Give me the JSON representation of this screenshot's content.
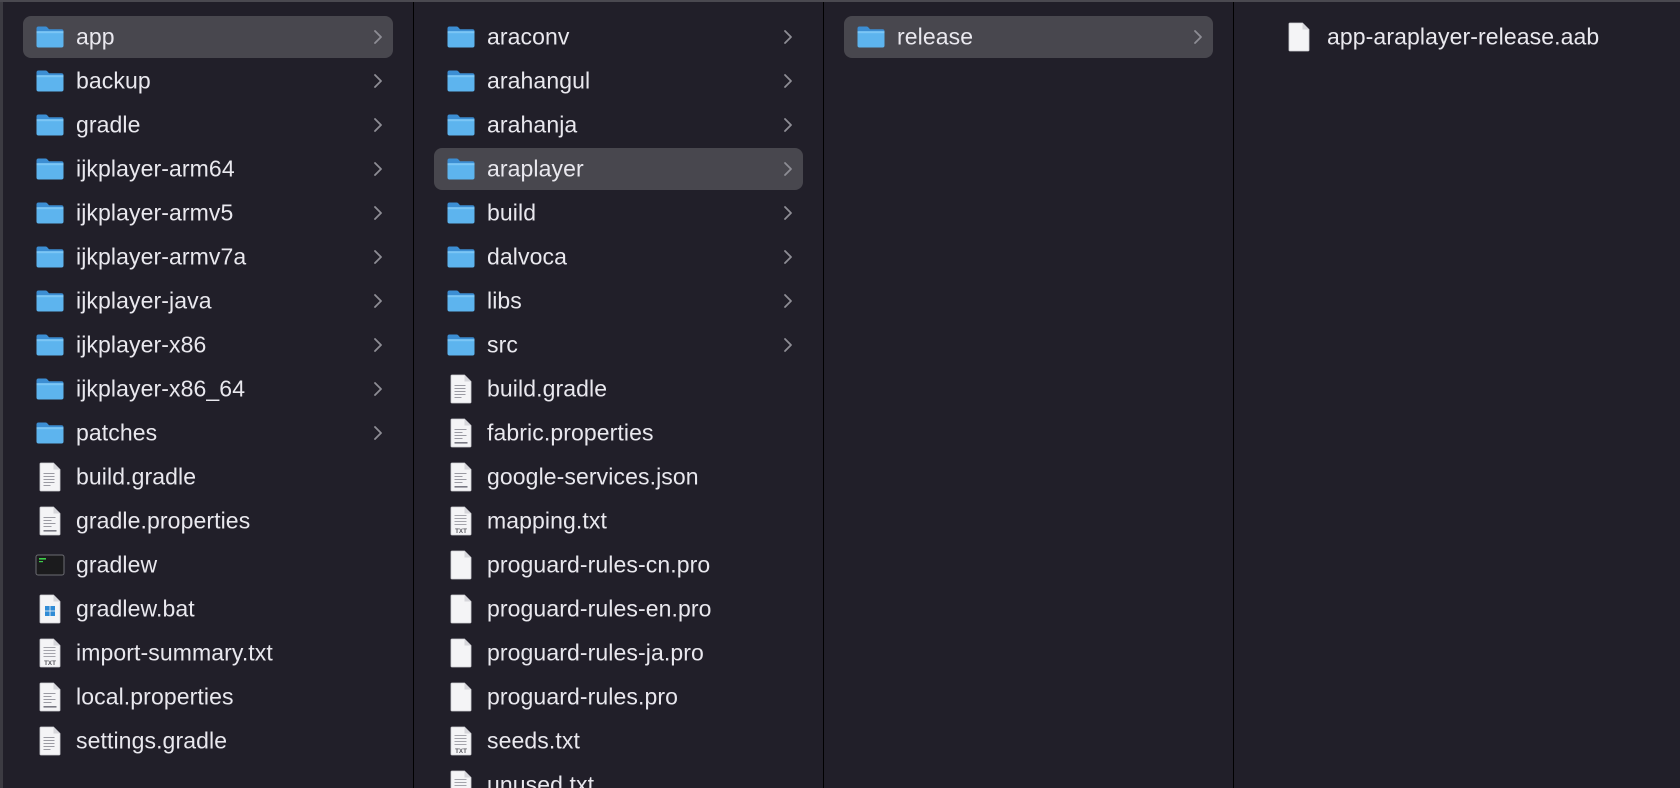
{
  "columns": [
    {
      "items": [
        {
          "label": "app",
          "type": "folder",
          "selected": true
        },
        {
          "label": "backup",
          "type": "folder"
        },
        {
          "label": "gradle",
          "type": "folder"
        },
        {
          "label": "ijkplayer-arm64",
          "type": "folder"
        },
        {
          "label": "ijkplayer-armv5",
          "type": "folder"
        },
        {
          "label": "ijkplayer-armv7a",
          "type": "folder"
        },
        {
          "label": "ijkplayer-java",
          "type": "folder"
        },
        {
          "label": "ijkplayer-x86",
          "type": "folder"
        },
        {
          "label": "ijkplayer-x86_64",
          "type": "folder"
        },
        {
          "label": "patches",
          "type": "folder"
        },
        {
          "label": "build.gradle",
          "type": "doc"
        },
        {
          "label": "gradle.properties",
          "type": "doc-props"
        },
        {
          "label": "gradlew",
          "type": "exec"
        },
        {
          "label": "gradlew.bat",
          "type": "bat"
        },
        {
          "label": "import-summary.txt",
          "type": "txt"
        },
        {
          "label": "local.properties",
          "type": "doc-props"
        },
        {
          "label": "settings.gradle",
          "type": "doc"
        }
      ]
    },
    {
      "items": [
        {
          "label": "araconv",
          "type": "folder"
        },
        {
          "label": "arahangul",
          "type": "folder"
        },
        {
          "label": "arahanja",
          "type": "folder"
        },
        {
          "label": "araplayer",
          "type": "folder",
          "selected": true
        },
        {
          "label": "build",
          "type": "folder"
        },
        {
          "label": "dalvoca",
          "type": "folder"
        },
        {
          "label": "libs",
          "type": "folder"
        },
        {
          "label": "src",
          "type": "folder"
        },
        {
          "label": "build.gradle",
          "type": "doc"
        },
        {
          "label": "fabric.properties",
          "type": "doc-props"
        },
        {
          "label": "google-services.json",
          "type": "doc-props"
        },
        {
          "label": "mapping.txt",
          "type": "txt"
        },
        {
          "label": "proguard-rules-cn.pro",
          "type": "blank"
        },
        {
          "label": "proguard-rules-en.pro",
          "type": "blank"
        },
        {
          "label": "proguard-rules-ja.pro",
          "type": "blank"
        },
        {
          "label": "proguard-rules.pro",
          "type": "blank"
        },
        {
          "label": "seeds.txt",
          "type": "txt"
        },
        {
          "label": "unused.txt",
          "type": "txt"
        }
      ]
    },
    {
      "items": [
        {
          "label": "release",
          "type": "folder",
          "selected": true
        }
      ]
    },
    {
      "items": [
        {
          "label": "app-araplayer-release.aab",
          "type": "blank"
        }
      ]
    }
  ],
  "icons": {
    "folder": "folder-icon",
    "doc": "document-icon",
    "doc-props": "properties-file-icon",
    "txt": "text-file-icon",
    "exec": "terminal-executable-icon",
    "bat": "windows-batch-file-icon",
    "blank": "blank-file-icon",
    "chevron": "chevron-right-icon"
  },
  "colors": {
    "background": "#211f29",
    "selected_row": "#48474e",
    "folder_blue": "#5db4ee",
    "text": "#e9e8ee"
  }
}
